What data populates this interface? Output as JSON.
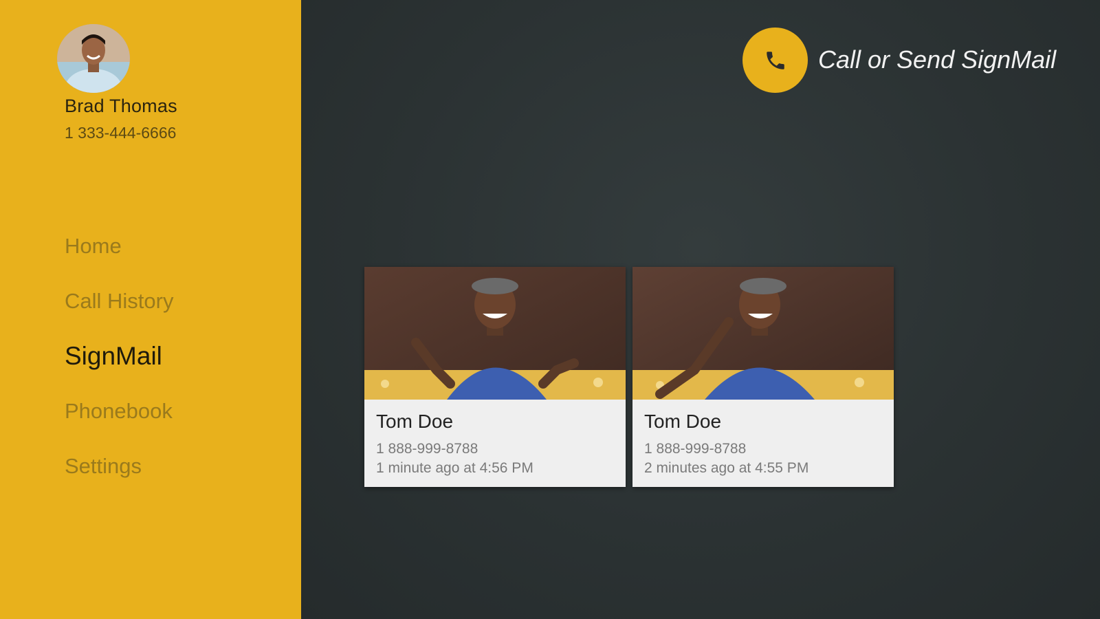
{
  "user": {
    "name": "Brad Thomas",
    "phone": "1 333-444-6666"
  },
  "nav": {
    "items": [
      {
        "label": "Home",
        "active": false
      },
      {
        "label": "Call History",
        "active": false
      },
      {
        "label": "SignMail",
        "active": true
      },
      {
        "label": "Phonebook",
        "active": false
      },
      {
        "label": "Settings",
        "active": false
      }
    ]
  },
  "header": {
    "call_label": "Call or Send SignMail",
    "call_icon": "phone-icon"
  },
  "signmails": [
    {
      "name": "Tom Doe",
      "phone": "1 888-999-8788",
      "time": "1 minute ago at 4:56 PM"
    },
    {
      "name": "Tom Doe",
      "phone": "1 888-999-8788",
      "time": "2 minutes ago at 4:55 PM"
    }
  ],
  "colors": {
    "accent": "#e8b11c",
    "background": "#2b3233",
    "card": "#efefef"
  }
}
